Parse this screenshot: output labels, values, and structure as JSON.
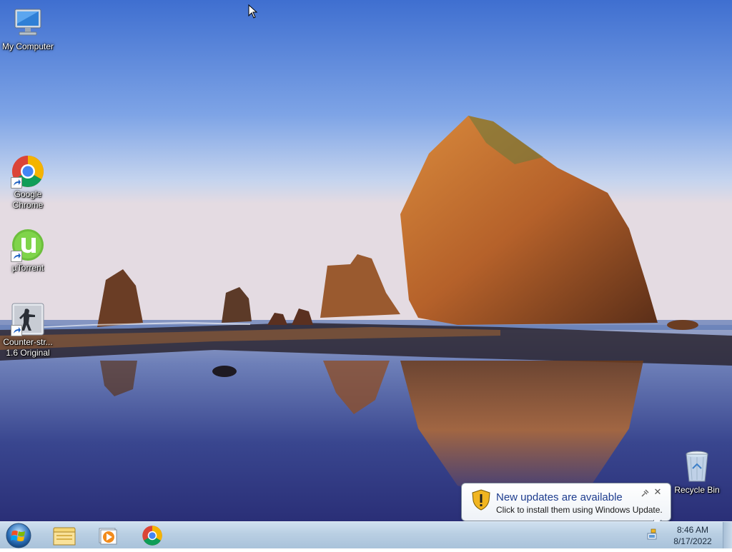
{
  "desktop": {
    "icons": [
      {
        "label": "My Computer"
      },
      {
        "label": "Google\nChrome"
      },
      {
        "label": "µTorrent"
      },
      {
        "label": "Counter-str...\n1.6 Original"
      },
      {
        "label": "Recycle Bin"
      }
    ]
  },
  "taskbar": {
    "pinned": [
      {
        "icon": "windows-explorer-icon"
      },
      {
        "icon": "media-player-icon"
      },
      {
        "icon": "chrome-icon"
      }
    ]
  },
  "clock": {
    "time": "8:46 AM",
    "date": "8/17/2022"
  },
  "notification": {
    "title": "New updates are available",
    "message": "Click to install them using Windows Update."
  },
  "colors": {
    "accent": "#1e3d8f",
    "taskbar": "#b9cfe3"
  }
}
